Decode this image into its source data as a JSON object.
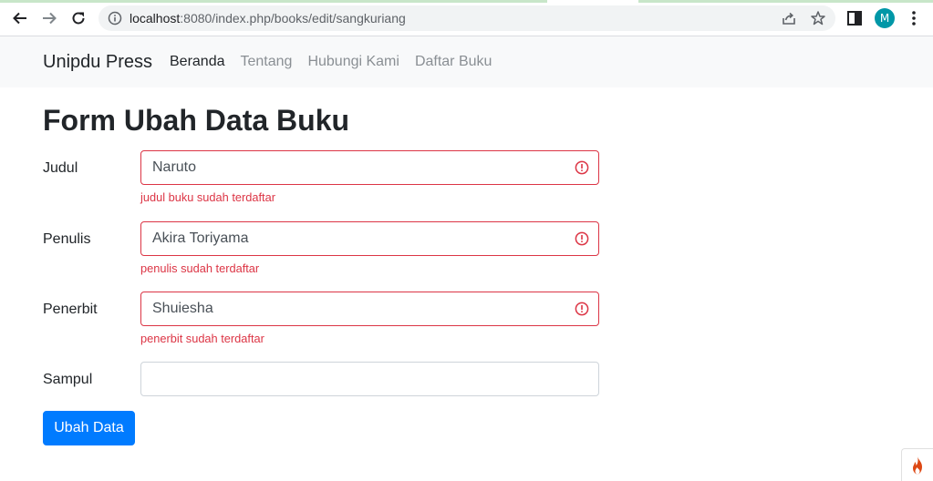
{
  "browser": {
    "url_host": "localhost",
    "url_rest": ":8080/index.php/books/edit/sangkuriang",
    "profile_initial": "M"
  },
  "navbar": {
    "brand": "Unipdu Press",
    "links": [
      {
        "label": "Beranda",
        "active": true
      },
      {
        "label": "Tentang",
        "active": false
      },
      {
        "label": "Hubungi Kami",
        "active": false
      },
      {
        "label": "Daftar Buku",
        "active": false
      }
    ]
  },
  "form": {
    "title": "Form Ubah Data Buku",
    "fields": [
      {
        "label": "Judul",
        "value": "Naruto",
        "error": "judul buku sudah terdaftar"
      },
      {
        "label": "Penulis",
        "value": "Akira Toriyama",
        "error": "penulis sudah terdaftar"
      },
      {
        "label": "Penerbit",
        "value": "Shuiesha",
        "error": "penerbit sudah terdaftar"
      },
      {
        "label": "Sampul",
        "value": "",
        "error": ""
      }
    ],
    "submit_label": "Ubah Data"
  },
  "colors": {
    "primary": "#007bff",
    "danger": "#dc3545",
    "navbar_bg": "#f8f9fa",
    "avatar_bg": "#0097a7"
  }
}
